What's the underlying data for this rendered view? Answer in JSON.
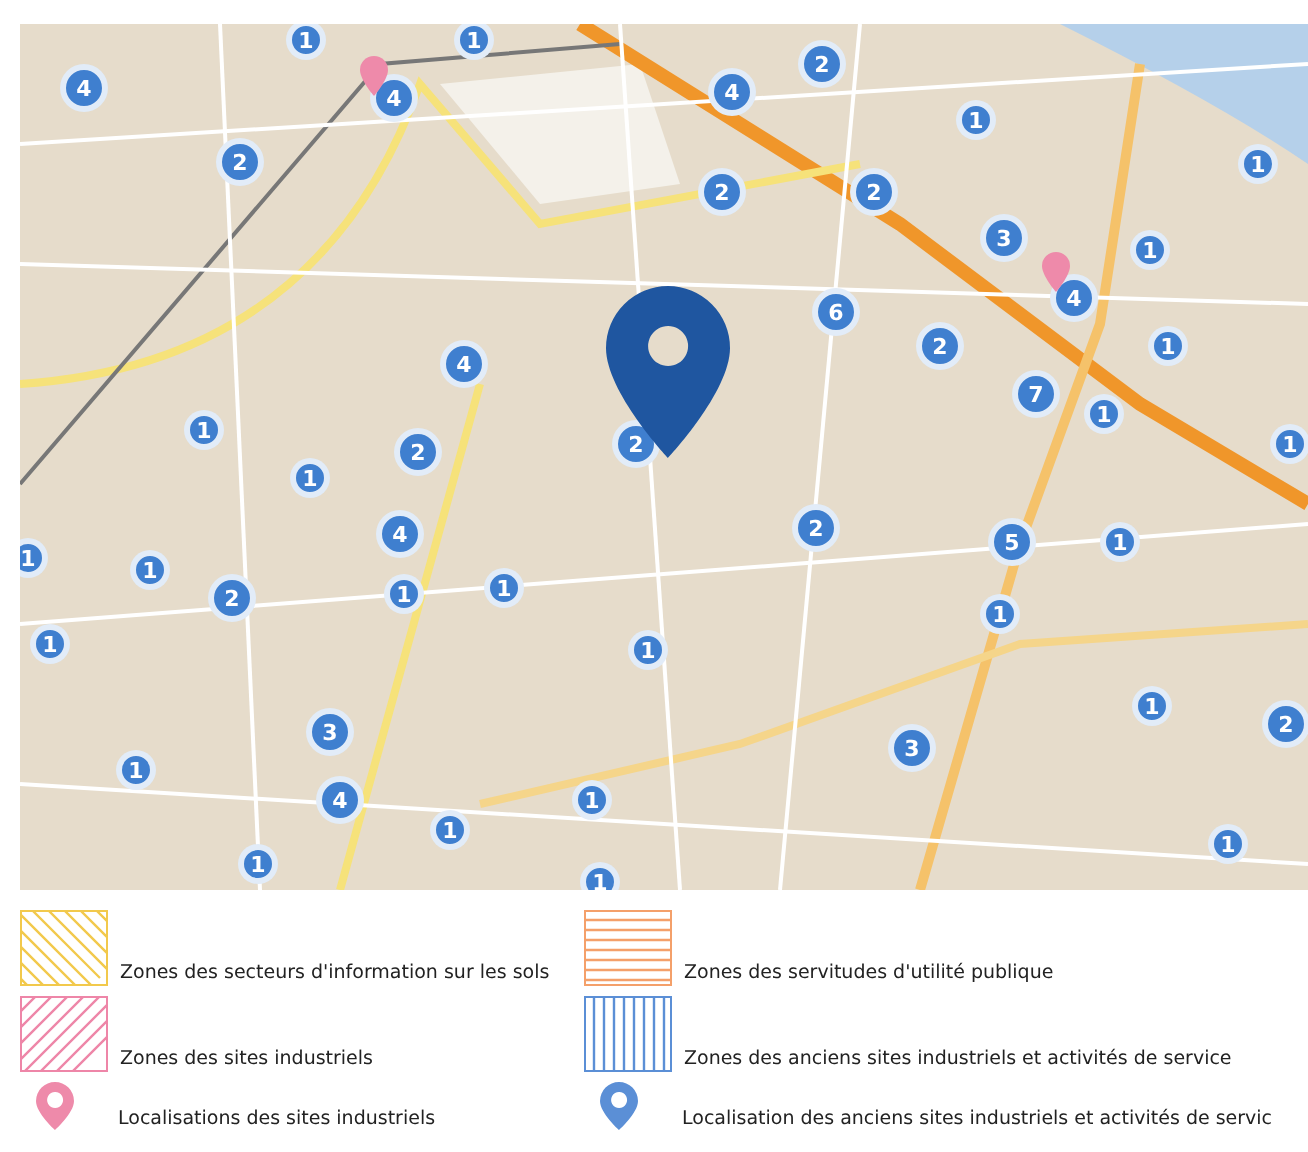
{
  "map": {
    "clusters": [
      {
        "count": "1"
      },
      {
        "count": "1"
      },
      {
        "count": "4"
      },
      {
        "count": "4"
      },
      {
        "count": "2"
      },
      {
        "count": "4"
      },
      {
        "count": "1"
      },
      {
        "count": "2"
      },
      {
        "count": "2"
      },
      {
        "count": "2"
      },
      {
        "count": "1"
      },
      {
        "count": "3"
      },
      {
        "count": "1"
      },
      {
        "count": "4"
      },
      {
        "count": "6"
      },
      {
        "count": "2"
      },
      {
        "count": "4"
      },
      {
        "count": "1"
      },
      {
        "count": "7"
      },
      {
        "count": "1"
      },
      {
        "count": "1"
      },
      {
        "count": "2"
      },
      {
        "count": "2"
      },
      {
        "count": "1"
      },
      {
        "count": "1"
      },
      {
        "count": "4"
      },
      {
        "count": "2"
      },
      {
        "count": "5"
      },
      {
        "count": "1"
      },
      {
        "count": "1"
      },
      {
        "count": "1"
      },
      {
        "count": "2"
      },
      {
        "count": "1"
      },
      {
        "count": "1"
      },
      {
        "count": "1"
      },
      {
        "count": "1"
      },
      {
        "count": "1"
      },
      {
        "count": "1"
      },
      {
        "count": "2"
      },
      {
        "count": "3"
      },
      {
        "count": "3"
      },
      {
        "count": "1"
      },
      {
        "count": "4"
      },
      {
        "count": "1"
      },
      {
        "count": "1"
      },
      {
        "count": "1"
      },
      {
        "count": "1"
      },
      {
        "count": "1"
      }
    ]
  },
  "legend": [
    {
      "kind": "hatchdown",
      "color": "#f2c94c",
      "label": "Zones des secteurs d'information sur les sols"
    },
    {
      "kind": "horizontal",
      "color": "#f4a06a",
      "label": "Zones des servitudes d'utilité publique"
    },
    {
      "kind": "hatchup",
      "color": "#ee86a8",
      "label": "Zones des sites industriels"
    },
    {
      "kind": "vertical",
      "color": "#5b8fd6",
      "label": "Zones des anciens sites industriels et activités de service"
    },
    {
      "kind": "pin",
      "color": "#ee8aaa",
      "label": "Localisations des sites industriels"
    },
    {
      "kind": "pin",
      "color": "#5b8fd6",
      "label": "Localisation des anciens sites industriels et activités de servic"
    }
  ]
}
